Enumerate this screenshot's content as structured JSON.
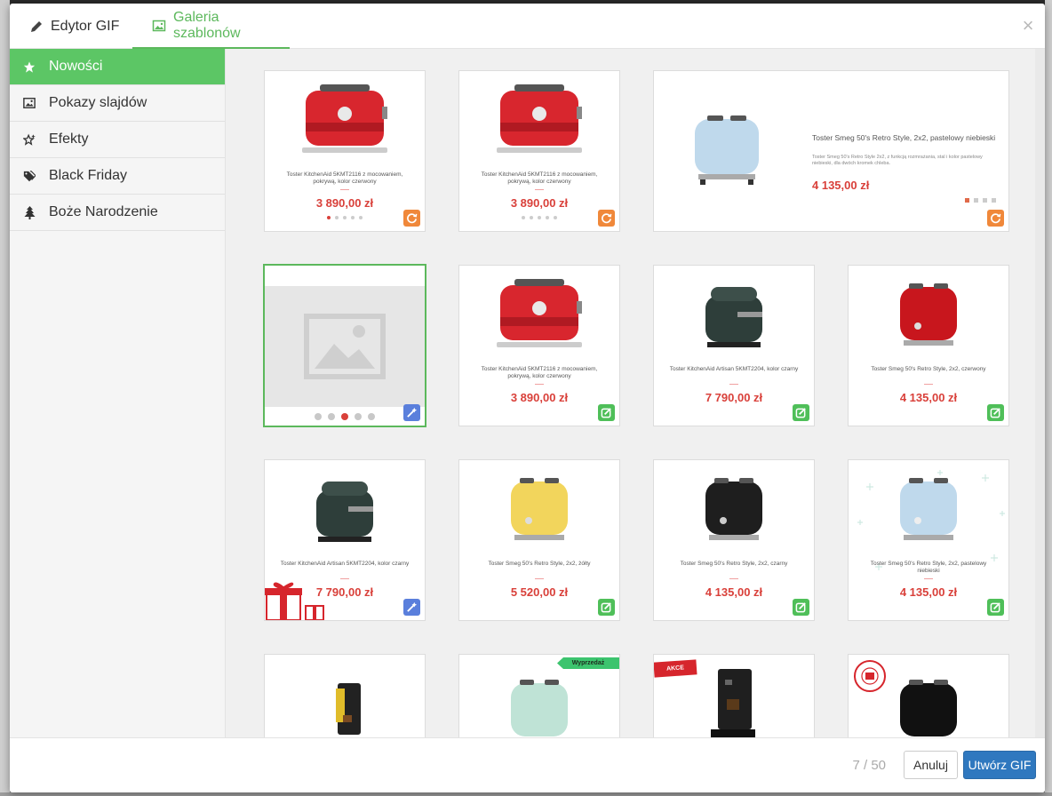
{
  "tabs": [
    {
      "label": "Edytor GIF",
      "icon": "pencil-icon"
    },
    {
      "label": "Galeria szablonów",
      "icon": "image-icon",
      "active": true
    }
  ],
  "close_glyph": "×",
  "sidebar": {
    "items": [
      {
        "label": "Nowości",
        "icon": "star-icon",
        "active": true
      },
      {
        "label": "Pokazy slajdów",
        "icon": "image-icon"
      },
      {
        "label": "Efekty",
        "icon": "star-sparkle-icon"
      },
      {
        "label": "Black Friday",
        "icon": "tags-icon"
      },
      {
        "label": "Boże Narodzenie",
        "icon": "tree-icon"
      }
    ]
  },
  "gallery": {
    "cards": [
      {
        "title": "Toster KitchenAid 5KMT2116 z mocowaniem, pokrywą, kolor czerwony",
        "price": "3 890,00 zł",
        "badge": "refresh-icon",
        "badge_color": "#f0883a",
        "product_color": "#d8262e"
      },
      {
        "title": "Toster KitchenAid 5KMT2116 z mocowaniem, pokrywą, kolor czerwony",
        "price": "3 890,00 zł",
        "badge": "refresh-icon",
        "badge_color": "#f0883a",
        "product_color": "#d8262e"
      },
      {
        "title": "Toster Smeg 50's Retro Style, 2x2, pastelowy niebieski",
        "description": "Toster Smeg 50's Retro Style 2x2, z funkcją rozmrażania, stal i kolor pastelowy niebieski, dla dwóch kromek chleba.",
        "price": "4 135,00 zł",
        "badge": "refresh-icon",
        "badge_color": "#f0883a",
        "product_color": "#bfd9ec"
      },
      {
        "title": "",
        "price": "",
        "badge": "magic-wand-icon",
        "badge_color": "#5a7fdc",
        "placeholder": true
      },
      {
        "title": "Toster KitchenAid 5KMT2116 z mocowaniem, pokrywą, kolor czerwony",
        "price": "3 890,00 zł",
        "badge": "edit-icon",
        "badge_color": "#4fbf59",
        "product_color": "#d8262e"
      },
      {
        "title": "Toster KitchenAid Artisan 5KMT2204, kolor czarny",
        "price": "7 790,00 zł",
        "badge": "edit-icon",
        "badge_color": "#4fbf59",
        "product_color": "#2e3e3a"
      },
      {
        "title": "Toster Smeg 50's Retro Style, 2x2, czerwony",
        "price": "4 135,00 zł",
        "badge": "edit-icon",
        "badge_color": "#4fbf59",
        "product_color": "#c8161d"
      },
      {
        "title": "Toster KitchenAid Artisan 5KMT2204, kolor czarny",
        "price": "7 790,00 zł",
        "badge": "magic-wand-icon",
        "badge_color": "#5a7fdc",
        "product_color": "#2e3e3a"
      },
      {
        "title": "Toster Smeg 50's Retro Style, 2x2, żółty",
        "price": "5 520,00 zł",
        "badge": "edit-icon",
        "badge_color": "#4fbf59",
        "product_color": "#f2d55c"
      },
      {
        "title": "Toster Smeg 50's Retro Style, 2x2, czarny",
        "price": "4 135,00 zł",
        "badge": "edit-icon",
        "badge_color": "#4fbf59",
        "product_color": "#1e1e1e"
      },
      {
        "title": "Toster Smeg 50's Retro Style, 2x2, pastelowy niebieski",
        "price": "4 135,00 zł",
        "badge": "edit-icon",
        "badge_color": "#4fbf59",
        "product_color": "#bfd9ec"
      },
      {
        "title": "",
        "price": "",
        "product_color": "#222"
      },
      {
        "title": "",
        "price": "",
        "product_color": "#bfe3d6",
        "ribbon": "Wyprzedaż"
      },
      {
        "title": "",
        "price": "",
        "product_color": "#1f1f1f",
        "ribbon": "AKCE"
      },
      {
        "title": "",
        "price": "",
        "product_color": "#111"
      }
    ]
  },
  "footer": {
    "counter": "7 / 50",
    "cancel_label": "Anuluj",
    "create_label": "Utwórz GIF"
  },
  "colors": {
    "accent": "#5cb85c",
    "price": "#d9403a",
    "primary_button": "#2f78bf"
  }
}
